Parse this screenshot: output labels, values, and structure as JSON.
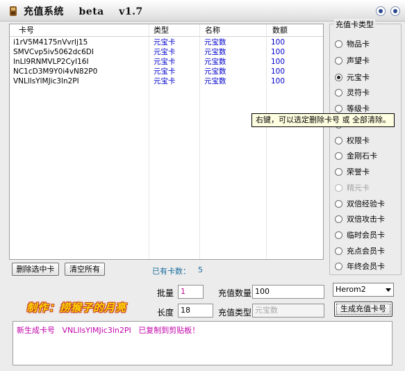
{
  "window": {
    "title": "充值系统    beta    v1.7"
  },
  "table": {
    "headers": [
      "卡号",
      "类型",
      "名称",
      "数额"
    ],
    "rows": [
      [
        "i1rV5M4175nVvrIj15",
        "元宝卡",
        "元宝数",
        "100"
      ],
      [
        "SMVCvp5iv5062dc6DI",
        "元宝卡",
        "元宝数",
        "100"
      ],
      [
        "lnLI9RNMVLP2CyI16I",
        "元宝卡",
        "元宝数",
        "100"
      ],
      [
        "NC1cD3M9Y0i4vN82P0",
        "元宝卡",
        "元宝数",
        "100"
      ],
      [
        "VNLllsYlMJic3ln2PI",
        "元宝卡",
        "元宝数",
        "100"
      ]
    ]
  },
  "buttons": {
    "delete_selected": "删除选中卡",
    "clear_all": "清空所有",
    "generate": "生成充值卡号"
  },
  "count": {
    "label": "已有卡数：",
    "value": "5"
  },
  "card_types": {
    "title": "充值卡类型",
    "items": [
      {
        "label": "物品卡",
        "checked": false,
        "disabled": false
      },
      {
        "label": "声望卡",
        "checked": false,
        "disabled": false
      },
      {
        "label": "元宝卡",
        "checked": true,
        "disabled": false
      },
      {
        "label": "灵符卡",
        "checked": false,
        "disabled": false
      },
      {
        "label": "等级卡",
        "checked": false,
        "disabled": false
      },
      {
        "label": "",
        "checked": false,
        "disabled": false
      },
      {
        "label": "权限卡",
        "checked": false,
        "disabled": false
      },
      {
        "label": "金刚石卡",
        "checked": false,
        "disabled": false
      },
      {
        "label": "荣誉卡",
        "checked": false,
        "disabled": false
      },
      {
        "label": "精元卡",
        "checked": false,
        "disabled": true
      },
      {
        "label": "双倍经验卡",
        "checked": false,
        "disabled": false
      },
      {
        "label": "双倍攻击卡",
        "checked": false,
        "disabled": false
      },
      {
        "label": "临时会员卡",
        "checked": false,
        "disabled": false
      },
      {
        "label": "充点会员卡",
        "checked": false,
        "disabled": false
      },
      {
        "label": "年终会员卡",
        "checked": false,
        "disabled": false
      }
    ]
  },
  "tooltip": "右键，可以选定删除卡号 或 全部清除。",
  "form": {
    "batch_label": "批量",
    "batch_value": "1",
    "length_label": "长度",
    "length_value": "18",
    "amount_label": "充值数量",
    "amount_value": "100",
    "type_label": "充值类型",
    "type_value": "元宝数"
  },
  "engine": {
    "selected": "Herom2"
  },
  "credit": "制作：捞猴子的月亮",
  "log": {
    "prefix": "新生成卡号",
    "card": "VNLllsYlMJic3ln2PI",
    "suffix": "已复制到剪贴板！"
  }
}
